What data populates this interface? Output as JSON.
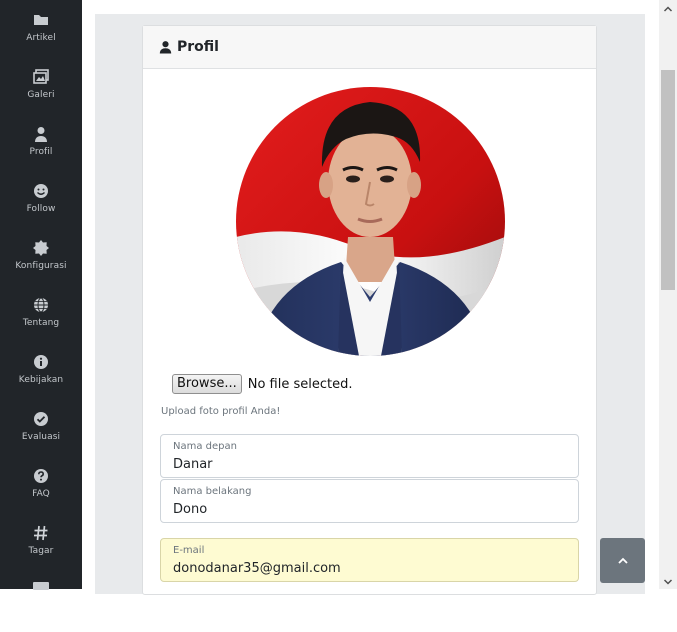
{
  "sidebar": {
    "items": [
      {
        "label": "Artikel",
        "icon": "folder-icon"
      },
      {
        "label": "Galeri",
        "icon": "images-icon"
      },
      {
        "label": "Profil",
        "icon": "user-icon"
      },
      {
        "label": "Follow",
        "icon": "smile-icon"
      },
      {
        "label": "Konfigurasi",
        "icon": "cog-icon"
      },
      {
        "label": "Tentang",
        "icon": "globe-icon"
      },
      {
        "label": "Kebijakan",
        "icon": "info-icon"
      },
      {
        "label": "Evaluasi",
        "icon": "check-circle-icon"
      },
      {
        "label": "FAQ",
        "icon": "question-icon"
      },
      {
        "label": "Tagar",
        "icon": "hashtag-icon"
      }
    ]
  },
  "card": {
    "title": "Profil",
    "icon": "user-icon"
  },
  "upload": {
    "browse_label": "Browse...",
    "status": "No file selected.",
    "help": "Upload foto profil Anda!"
  },
  "form": {
    "first_name": {
      "label": "Nama depan",
      "value": "Danar"
    },
    "last_name": {
      "label": "Nama belakang",
      "value": "Dono"
    },
    "email": {
      "label": "E-mail",
      "value": "donodanar35@gmail.com"
    }
  },
  "colors": {
    "sidebar_bg": "#212529",
    "wrapper_bg": "#e8eaec",
    "autofill_bg": "#fefbd2",
    "back_to_top_bg": "#6c757d"
  }
}
